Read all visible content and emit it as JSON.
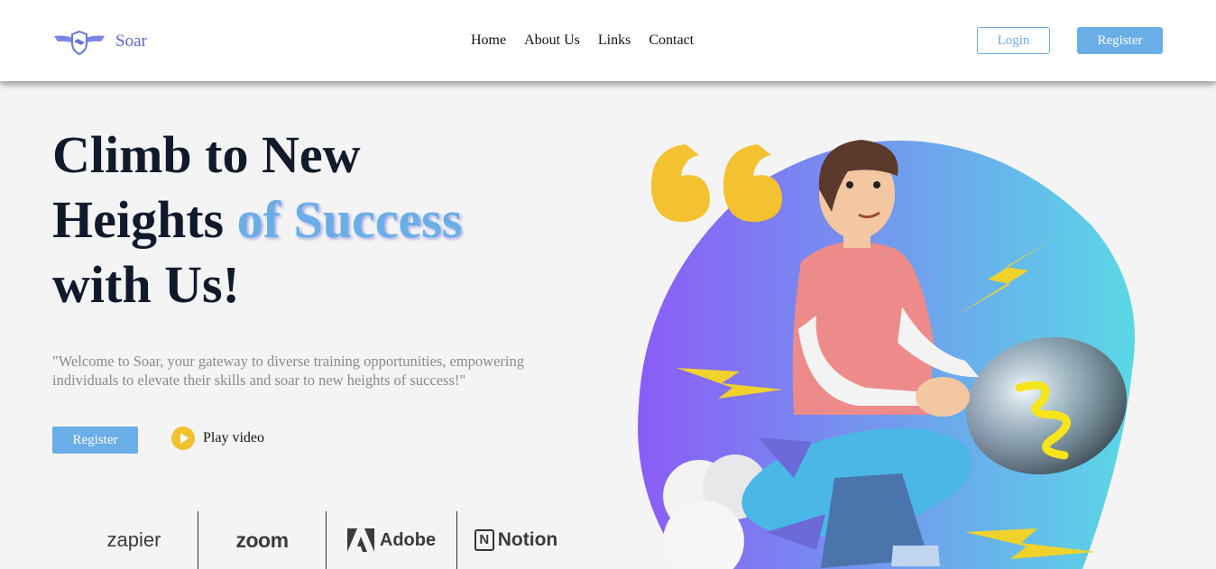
{
  "header": {
    "brand": "Soar",
    "nav": [
      "Home",
      "About Us",
      "Links",
      "Contact"
    ],
    "login_label": "Login",
    "register_label": "Register"
  },
  "hero": {
    "title_line1": "Climb to New",
    "title_line2_plain": "Heights ",
    "title_line2_accent": "of Success",
    "title_line3": "with Us!",
    "description": "\"Welcome to Soar, your gateway to diverse training opportunities, empowering individuals to elevate their skills and soar to new heights of success!\"",
    "register_label": "Register",
    "play_label": "Play video"
  },
  "partners": [
    "zapier",
    "zoom",
    "Adobe",
    "Notion"
  ],
  "colors": {
    "accent": "#6aaee8",
    "brand": "#5a63d9",
    "heading": "#111a2c",
    "play": "#f2c12e",
    "blob_start": "#8a5cf6",
    "blob_end": "#5ad8e6"
  }
}
